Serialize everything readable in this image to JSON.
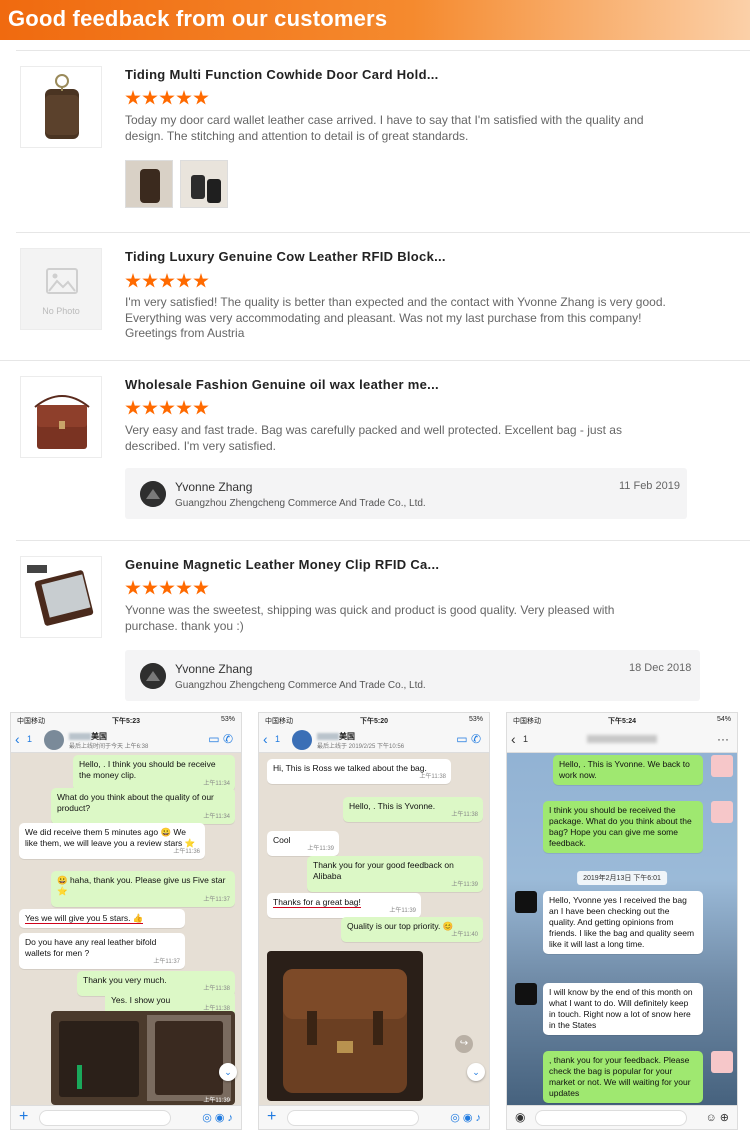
{
  "banner": {
    "title": "Good feedback from our customers",
    "gradient_start": "#f06a0f",
    "gradient_end": "#fbd0a8"
  },
  "star_color": "#ff6a00",
  "reviews": [
    {
      "title": "Tiding Multi Function Cowhide Door Card Hold...",
      "rating": 5,
      "text": "Today my door card wallet leather case arrived. I have to say that I'm satisfied with the quality and design. The stitching and attention to detail is of great standards."
    },
    {
      "title": "Tiding Luxury Genuine Cow Leather RFID Block...",
      "rating": 5,
      "no_photo_label": "No Photo",
      "text": "I'm very satisfied! The quality is better than expected and the contact with Yvonne Zhang is very good. Everything was very accommodating and pleasant. Was not my last purchase from this company! Greetings from Austria"
    },
    {
      "title": "Wholesale Fashion Genuine oil wax leather me...",
      "rating": 5,
      "text": "Very easy and fast trade. Bag was carefully packed and well protected. Excellent bag - just as described. I'm very satisfied.",
      "reply": {
        "name": "Yvonne Zhang",
        "company": "Guangzhou Zhengcheng Commerce And Trade Co., Ltd.",
        "date": "11 Feb 2019"
      }
    },
    {
      "title": "Genuine Magnetic Leather Money Clip RFID Ca...",
      "rating": 5,
      "text": "Yvonne was the sweetest, shipping was quick and product is good quality. Very pleased with purchase. thank you :)",
      "reply": {
        "name": "Yvonne Zhang",
        "company": "Guangzhou Zhengcheng Commerce And Trade Co., Ltd.",
        "date": "18 Dec 2018"
      }
    }
  ],
  "phones": [
    {
      "carrier": "中国移动",
      "time": "下午5:23",
      "battery": "53%",
      "back_count": "1",
      "contact_suffix": "美国",
      "status": "最后上线时间于今天 上午6:38",
      "messages": [
        {
          "dir": "out",
          "text": "Hello,        . I think you should be receive the money clip.",
          "time": "上午11:34"
        },
        {
          "dir": "out",
          "text": "What do you think about the quality of our product?",
          "time": "上午11:34"
        },
        {
          "dir": "in",
          "text": "We did receive them 5 minutes ago 😀 We like them, we will leave you a review stars ⭐",
          "time": "上午11:36"
        },
        {
          "dir": "out",
          "text": "😀 haha, thank you. Please give us Five star ⭐",
          "time": "上午11:37"
        },
        {
          "dir": "in",
          "text": "Yes we will give you 5 stars. 👍",
          "time": ""
        },
        {
          "dir": "in",
          "text": "Do you have any real leather bifold wallets for men ?",
          "time": "上午11:37"
        },
        {
          "dir": "out",
          "text": "Thank you very much.",
          "time": "上午11:38"
        },
        {
          "dir": "out",
          "text": "Yes. I show you",
          "time": "上午11:38"
        }
      ],
      "photo_time": "上午11:39"
    },
    {
      "carrier": "中国移动",
      "time": "下午5:20",
      "battery": "53%",
      "back_count": "1",
      "contact_suffix": "美国",
      "status": "最后上线于 2019/2/25 下午10:56",
      "messages": [
        {
          "dir": "in",
          "text": "Hi, This is          Ross we talked about the bag.",
          "time": "上午11:38"
        },
        {
          "dir": "out",
          "text": "Hello,          . This is Yvonne.",
          "time": "上午11:38"
        },
        {
          "dir": "in",
          "text": "Cool",
          "time": "上午11:39"
        },
        {
          "dir": "out",
          "text": "Thank you for your good feedback on Alibaba",
          "time": "上午11:39"
        },
        {
          "dir": "in",
          "text": "Thanks for a great bag!",
          "time": "上午11:39"
        },
        {
          "dir": "out",
          "text": "Quality is our top priority. 😊",
          "time": "上午11:40"
        }
      ]
    },
    {
      "carrier": "中国移动",
      "time": "下午5:24",
      "battery": "54%",
      "back_count": "1",
      "date_chip": "2019年2月13日 下午6:01",
      "messages": [
        {
          "dir": "out",
          "text": "Hello,            . This is Yvonne. We back to work now."
        },
        {
          "dir": "out",
          "text": "I think you should be received the package. What do you think about the bag? Hope you can give me some feedback."
        },
        {
          "dir": "in",
          "text": "Hello, Yvonne yes I received the bag an I have been checking out the quality. And getting opinions from friends. I like the bag and quality seem like it will last a long time."
        },
        {
          "dir": "in",
          "text": "I will know by the end of this month on what I want to do. Will definitely keep in touch. Right now a lot of snow here in the States"
        },
        {
          "dir": "out",
          "text": "           , thank you for your feedback. Please check the bag is popular for your market or not. We will waiting for your updates"
        }
      ]
    }
  ]
}
